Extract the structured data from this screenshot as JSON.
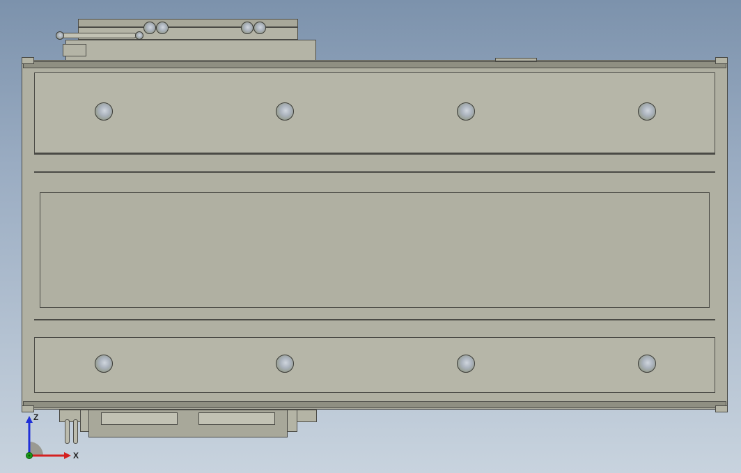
{
  "axis_labels": {
    "x": "X",
    "z": "Z"
  },
  "axis_colors": {
    "x": "#d42020",
    "y": "#1a9a1a",
    "z": "#2030d8"
  },
  "model": {
    "holes_top_row": 4,
    "holes_bottom_row": 4
  }
}
